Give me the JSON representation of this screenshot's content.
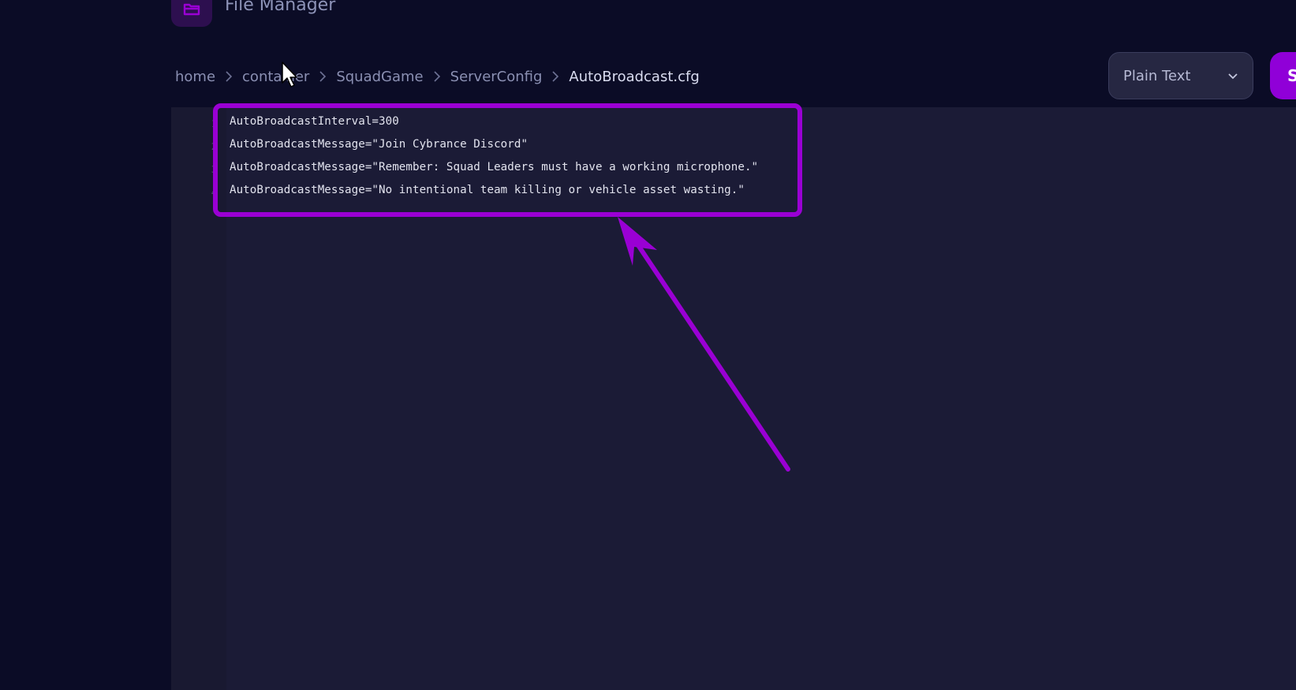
{
  "header": {
    "title": "File Manager",
    "icon": "folder-icon"
  },
  "breadcrumb": {
    "items": [
      "home",
      "container",
      "SquadGame",
      "ServerConfig",
      "AutoBroadcast.cfg"
    ]
  },
  "toolbar": {
    "language_value": "Plain Text",
    "save_label": "S"
  },
  "editor": {
    "line_numbers": [
      "1",
      "2",
      "3",
      "4"
    ],
    "lines": [
      "AutoBroadcastInterval=300",
      "AutoBroadcastMessage=\"Join Cybrance Discord\"",
      "AutoBroadcastMessage=\"Remember: Squad Leaders must have a working microphone.\"",
      "AutoBroadcastMessage=\"No intentional team killing or vehicle asset wasting.\""
    ]
  },
  "colors": {
    "background": "#0b0c26",
    "editor_background": "#1b1b36",
    "accent": "#9000d8",
    "annotation": "#9a00d4"
  }
}
